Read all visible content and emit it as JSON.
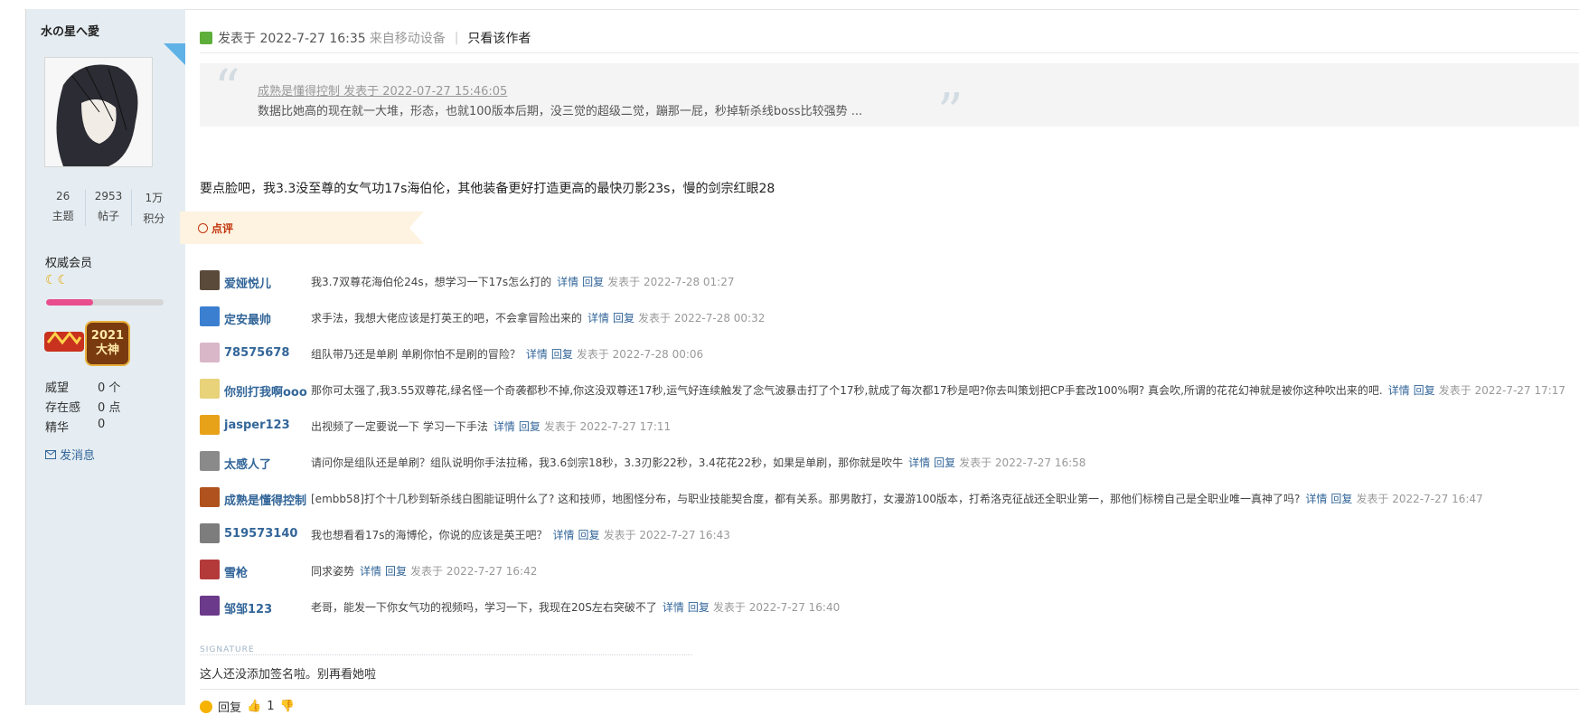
{
  "sidebar": {
    "username": "水の星へ愛",
    "stats": [
      {
        "value": "26",
        "label": "主题"
      },
      {
        "value": "2953",
        "label": "帖子"
      },
      {
        "value": "1万",
        "label": "积分"
      }
    ],
    "rank": "权威会员",
    "moons": "☾☾",
    "level_progress": 0.4,
    "medal2_text": "2021 大神",
    "attributes": [
      {
        "key": "威望",
        "value": "0 个"
      },
      {
        "key": "存在感",
        "value": "0 点"
      },
      {
        "key": "精华",
        "value": "0"
      }
    ],
    "send_message": "发消息"
  },
  "post": {
    "posted_at": "发表于 2022-7-27 16:35",
    "from_device": "来自移动设备",
    "only_author": "只看该作者",
    "quote": {
      "header": "成熟是懂得控制 发表于 2022-07-27 15:46:05",
      "body": "数据比她高的现在就一大堆，形态，也就100版本后期，没三觉的超级二觉，蹦那一屁，秒掉斩杀线boss比较强势 ..."
    },
    "body": "要点脸吧，我3.3没至尊的女气功17s海伯伦，其他装备更好打造更高的最快刃影23s，慢的剑宗红眼28"
  },
  "review_label": "点评",
  "comments": [
    {
      "name": "爱娅悦儿",
      "text": "我3.7双尊花海伯伦24s，想学习一下17s怎么打的",
      "detail": "详情",
      "reply": "回复",
      "time": "发表于 2022-7-28 01:27",
      "color": "#5a4a3a"
    },
    {
      "name": "定安最帅",
      "text": "求手法，我想大佬应该是打英王的吧，不会拿冒险出来的",
      "detail": "详情",
      "reply": "回复",
      "time": "发表于 2022-7-28 00:32",
      "color": "#3b7fd1"
    },
    {
      "name": "78575678",
      "text": "组队带乃还是单刷 单刷你怕不是刷的冒险？",
      "detail": "详情",
      "reply": "回复",
      "time": "发表于 2022-7-28 00:06",
      "color": "#d9b7c9"
    },
    {
      "name": "你别打我啊ooo",
      "text": "那你可太强了,我3.55双尊花,绿名怪一个奇袭都秒不掉,你这没双尊还17秒,运气好连续触发了念气波暴击打了个17秒,就成了每次都17秒是吧?你去叫策划把CP手套改100%啊? 真会吹,所谓的花花幻神就是被你这种吹出来的吧.",
      "detail": "详情",
      "reply": "回复",
      "time": "发表于 2022-7-27 17:17",
      "color": "#e8d27a"
    },
    {
      "name": "jasper123",
      "text": "出视频了一定要说一下 学习一下手法",
      "detail": "详情",
      "reply": "回复",
      "time": "发表于 2022-7-27 17:11",
      "color": "#e8a21a"
    },
    {
      "name": "太感人了",
      "text": "请问你是组队还是单刷？组队说明你手法拉稀，我3.6剑宗18秒，3.3刃影22秒，3.4花花22秒，如果是单刷，那你就是吹牛",
      "detail": "详情",
      "reply": "回复",
      "time": "发表于 2022-7-27 16:58",
      "color": "#8a8a8a"
    },
    {
      "name": "成熟是懂得控制",
      "text": "[embb58]打个十几秒到斩杀线白图能证明什么了? 这和技师，地图怪分布，与职业技能契合度，都有关系。那男散打，女漫游100版本，打希洛克征战还全职业第一，那他们标榜自己是全职业唯一真神了吗?",
      "detail": "详情",
      "reply": "回复",
      "time": "发表于 2022-7-27 16:47",
      "color": "#b0521e"
    },
    {
      "name": "519573140",
      "text": "我也想看看17s的海博伦，你说的应该是英王吧？",
      "detail": "详情",
      "reply": "回复",
      "time": "发表于 2022-7-27 16:43",
      "color": "#7d7d7d"
    },
    {
      "name": "雪枪",
      "text": "同求姿势",
      "detail": "详情",
      "reply": "回复",
      "time": "发表于 2022-7-27 16:42",
      "color": "#b43a3a"
    },
    {
      "name": "邹邹123",
      "text": "老哥，能发一下你女气功的视频吗，学习一下，我现在20S左右突破不了",
      "detail": "详情",
      "reply": "回复",
      "time": "发表于 2022-7-27 16:40",
      "color": "#6b3a8a"
    }
  ],
  "signature_label": "SIGNATURE",
  "signature_text": "这人还没添加签名啦。别再看她啦",
  "footer": {
    "reply": "回复",
    "likes": "1"
  }
}
